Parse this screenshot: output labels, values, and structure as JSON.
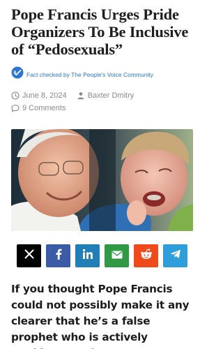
{
  "article": {
    "title": "Pope Francis Urges Pride Organizers To Be Inclusive of “Pedosexuals”",
    "fact_check": "Fact checked by The People's Voice Community",
    "date": "June 8, 2024",
    "author": "Baxter Dmitry",
    "comments": "9 Comments",
    "lede": "If you thought Pope Francis could not possibly make it any clearer that he’s a false prophet who is actively working to subvert"
  },
  "share": [
    {
      "name": "x",
      "color": "#000000",
      "icon": "x-icon"
    },
    {
      "name": "facebook",
      "color": "#3b5ba6",
      "icon": "facebook-icon"
    },
    {
      "name": "linkedin",
      "color": "#1f7fb6",
      "icon": "linkedin-icon"
    },
    {
      "name": "email",
      "color": "#2f9a43",
      "icon": "email-icon"
    },
    {
      "name": "reddit",
      "color": "#f04a1c",
      "icon": "reddit-icon"
    },
    {
      "name": "telegram",
      "color": "#2d9ed9",
      "icon": "telegram-icon"
    }
  ],
  "colors": {
    "fact_check_blue": "#2a76d2",
    "meta_gray": "#8a8a8a"
  }
}
